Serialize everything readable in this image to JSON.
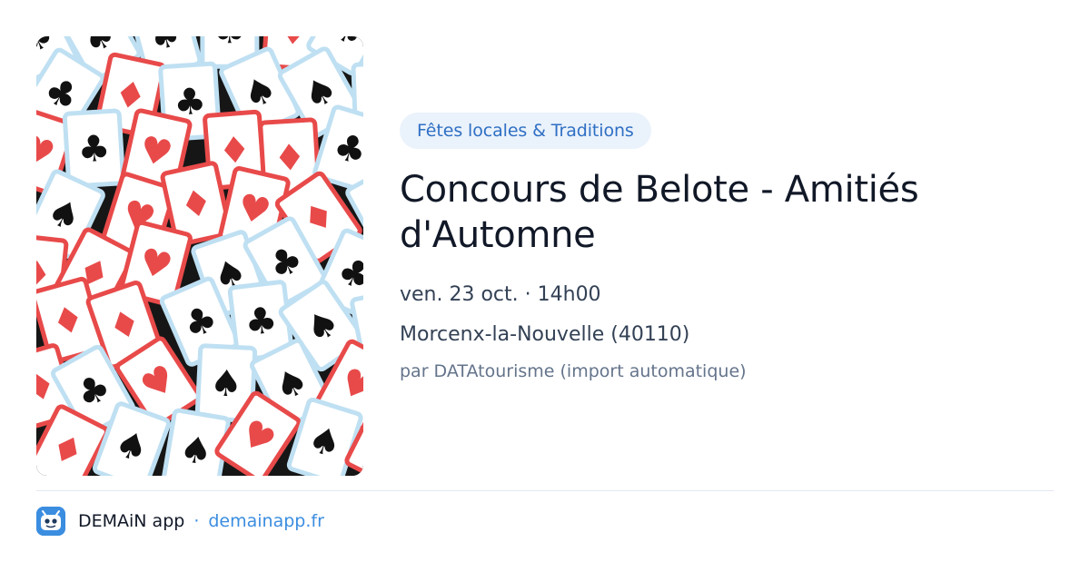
{
  "event": {
    "category": "Fêtes locales & Traditions",
    "title": "Concours de Belote - Amitiés d'Automne",
    "date": "ven. 23 oct. · 14h00",
    "location": "Morcenx-la-Nouvelle (40110)",
    "source": "par DATAtourisme (import automatique)"
  },
  "footer": {
    "app_name": "DEMAiN app",
    "separator": "·",
    "domain": "demainapp.fr"
  },
  "colors": {
    "accent": "#3b8de0",
    "card_red": "#e84a4a",
    "card_blue_border": "#bfe0f2"
  }
}
